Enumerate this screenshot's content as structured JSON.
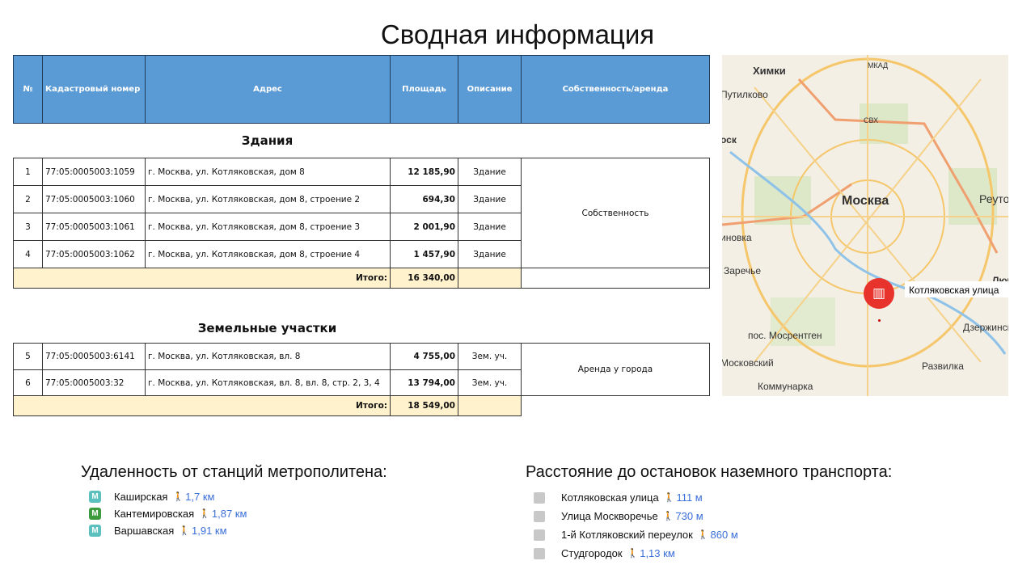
{
  "title": "Сводная информация",
  "table": {
    "headers": [
      "№",
      "Кадастровый  номер",
      "Адрес",
      "Площадь",
      "Описание",
      "Собственность/аренда"
    ],
    "buildings": {
      "section": "Здания",
      "rows": [
        {
          "n": "1",
          "cad": "77:05:0005003:1059",
          "addr": "г. Москва, ул.  Котляковская, дом 8",
          "area": "12 185,90",
          "desc": "Здание"
        },
        {
          "n": "2",
          "cad": "77:05:0005003:1060",
          "addr": "г. Москва, ул.  Котляковская, дом 8, строение 2",
          "area": "694,30",
          "desc": "Здание"
        },
        {
          "n": "3",
          "cad": "77:05:0005003:1061",
          "addr": "г. Москва, ул.  Котляковская, дом 8, строение 3",
          "area": "2 001,90",
          "desc": "Здание"
        },
        {
          "n": "4",
          "cad": "77:05:0005003:1062",
          "addr": "г. Москва, ул.  Котляковская, дом 8, строение 4",
          "area": "1 457,90",
          "desc": "Здание"
        }
      ],
      "ownership": "Собственность",
      "total_label": "Итого:",
      "total": "16 340,00"
    },
    "land": {
      "section": "Земельные участки",
      "rows": [
        {
          "n": "5",
          "cad": "77:05:0005003:6141",
          "addr": "г. Москва, ул. Котляковская, вл. 8",
          "area": "4 755,00",
          "desc": "Зем. уч."
        },
        {
          "n": "6",
          "cad": "77:05:0005003:32",
          "addr": "г. Москва, ул. Котляковская, вл. 8, вл. 8, стр. 2, 3, 4",
          "area": "13 794,00",
          "desc": "Зем. уч."
        }
      ],
      "ownership": "Аренда у города",
      "total_label": "Итого:",
      "total": "18 549,00"
    }
  },
  "map": {
    "labels": [
      "Химки",
      "Путилково",
      "МКАД",
      "СВХ",
      "Москва",
      "Реутов",
      "Заречье",
      "Котляковская улица",
      "пос. Мосрентген",
      "Дзержинский",
      "Московский",
      "Развилка",
      "Коммунарка",
      "Люберцы",
      "иновка",
      "оск"
    ],
    "marker": "building-icon",
    "marker_color": "#e8322c"
  },
  "metro": {
    "title": "Удаленность от станций метрополитена:",
    "items": [
      {
        "name": "Каширская",
        "dist": "1,7 км",
        "color": "#5bc0be"
      },
      {
        "name": "Кантемировская",
        "dist": "1,87 км",
        "color": "#3c9b3c"
      },
      {
        "name": "Варшавская",
        "dist": "1,91 км",
        "color": "#5bc0be"
      }
    ]
  },
  "transport": {
    "title": "Расстояние до остановок наземного транспорта:",
    "items": [
      {
        "name": "Котляковская улица",
        "dist": "111 м"
      },
      {
        "name": "Улица Москворечье",
        "dist": "730 м"
      },
      {
        "name": "1-й Котляковский переулок",
        "dist": "860 м"
      },
      {
        "name": "Студгородок",
        "dist": "1,13 км"
      }
    ]
  }
}
